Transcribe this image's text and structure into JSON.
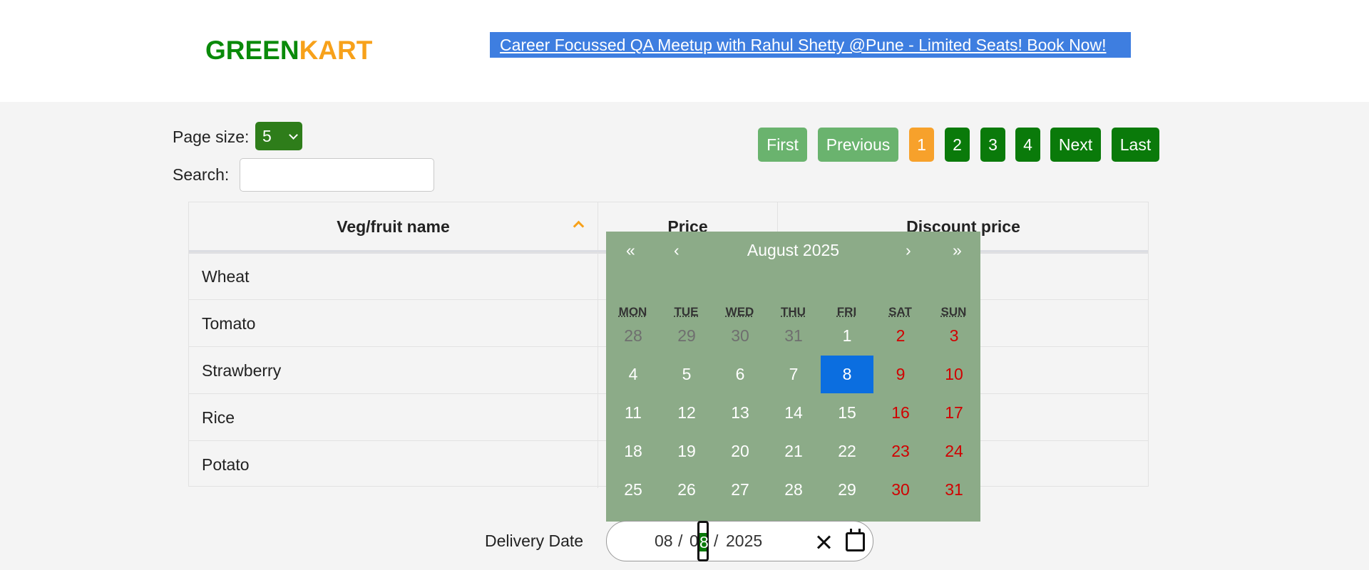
{
  "header": {
    "logo_green": "GREEN",
    "logo_kart": "KART",
    "promo_link": "Career Focussed QA Meetup with Rahul Shetty @Pune - Limited Seats! Book Now!"
  },
  "controls": {
    "page_size_label": "Page size:",
    "page_size_value": "5",
    "search_label": "Search:",
    "search_value": ""
  },
  "pagination": {
    "first": "First",
    "previous": "Previous",
    "pages": [
      "1",
      "2",
      "3",
      "4"
    ],
    "current_page": "1",
    "next": "Next",
    "last": "Last"
  },
  "table": {
    "headers": [
      "Veg/fruit name",
      "Price",
      "Discount price"
    ],
    "sort_column": "Veg/fruit name",
    "sort_direction": "ascending",
    "rows": [
      {
        "name": "Wheat"
      },
      {
        "name": "Tomato"
      },
      {
        "name": "Strawberry"
      },
      {
        "name": "Rice"
      },
      {
        "name": "Potato"
      }
    ]
  },
  "calendar": {
    "nav_prev_year": "«",
    "nav_prev_month": "‹",
    "title": "August 2025",
    "nav_next_month": "›",
    "nav_next_year": "»",
    "weekdays": [
      "MON",
      "TUE",
      "WED",
      "THU",
      "FRI",
      "SAT",
      "SUN"
    ],
    "weeks": [
      [
        "28",
        "29",
        "30",
        "31",
        "1",
        "2",
        "3"
      ],
      [
        "4",
        "5",
        "6",
        "7",
        "8",
        "9",
        "10"
      ],
      [
        "11",
        "12",
        "13",
        "14",
        "15",
        "16",
        "17"
      ],
      [
        "18",
        "19",
        "20",
        "21",
        "22",
        "23",
        "24"
      ],
      [
        "25",
        "26",
        "27",
        "28",
        "29",
        "30",
        "31"
      ]
    ],
    "selected_day": "8",
    "colors": {
      "background": "#8cab88",
      "selected": "#0b6ee0",
      "weekend": "#d10000",
      "muted": "#6f6f6f"
    }
  },
  "delivery": {
    "label": "Delivery Date",
    "month": "08",
    "sep1": "/",
    "day_prefix": "0",
    "day_focus": "8",
    "sep2": "/",
    "year": "2025"
  },
  "icons": {
    "clear": "close-icon",
    "calendar": "calendar-icon",
    "sort": "chevron-up-icon",
    "dropdown": "chevron-down-icon"
  }
}
